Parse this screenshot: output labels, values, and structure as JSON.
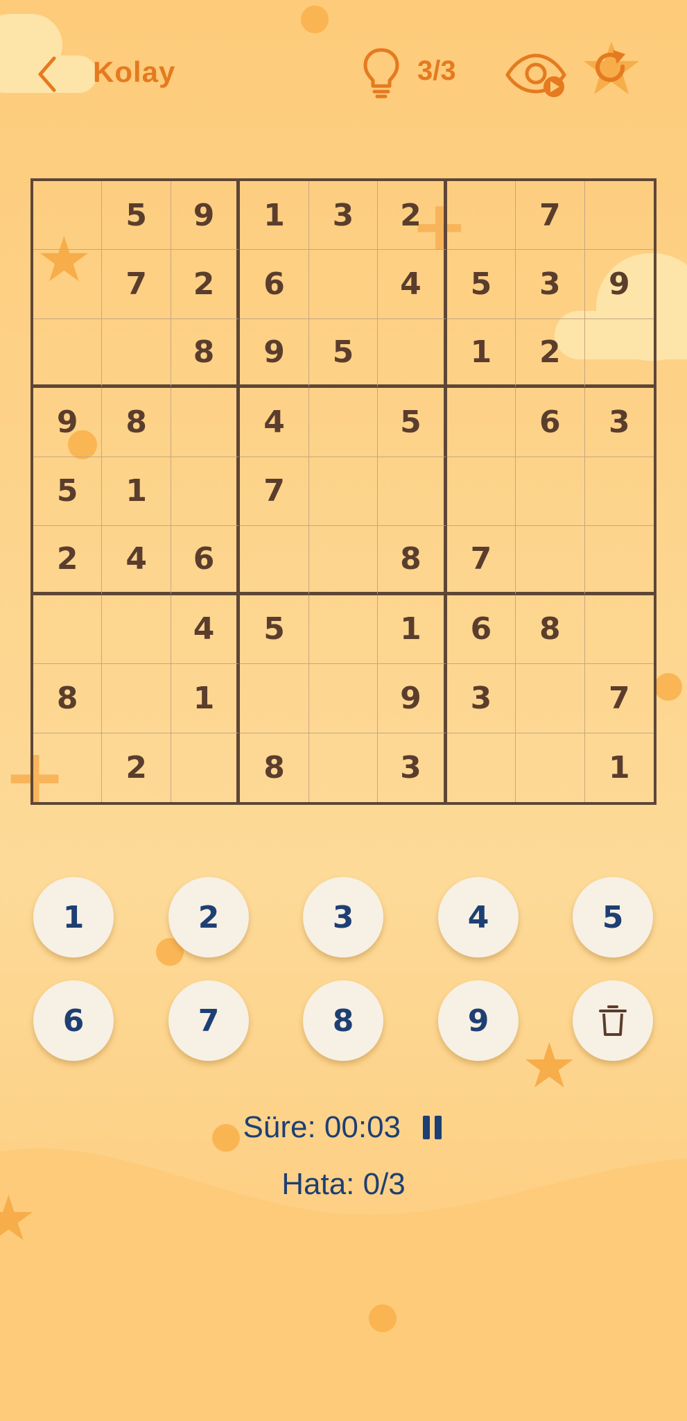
{
  "header": {
    "level_title": "Kolay",
    "hint_count": "3/3",
    "icons": [
      "chevron-left-icon",
      "lightbulb-icon",
      "eye-icon",
      "restart-icon"
    ]
  },
  "board": {
    "rows": [
      [
        "",
        "5",
        "9",
        "1",
        "3",
        "2",
        "",
        "7",
        ""
      ],
      [
        "",
        "7",
        "2",
        "6",
        "",
        "4",
        "5",
        "3",
        "9"
      ],
      [
        "",
        "",
        "8",
        "9",
        "5",
        "",
        "1",
        "2",
        ""
      ],
      [
        "9",
        "8",
        "",
        "4",
        "",
        "5",
        "",
        "6",
        "3"
      ],
      [
        "5",
        "1",
        "",
        "7",
        "",
        "",
        "",
        "",
        ""
      ],
      [
        "2",
        "4",
        "6",
        "",
        "",
        "8",
        "7",
        "",
        ""
      ],
      [
        "",
        "",
        "4",
        "5",
        "",
        "1",
        "6",
        "8",
        ""
      ],
      [
        "8",
        "",
        "1",
        "",
        "",
        "9",
        "3",
        "",
        "7"
      ],
      [
        "",
        "2",
        "",
        "8",
        "",
        "3",
        "",
        "",
        "1"
      ]
    ]
  },
  "keypad": {
    "keys": [
      "1",
      "2",
      "3",
      "4",
      "5",
      "6",
      "7",
      "8",
      "9"
    ],
    "erase_icon": "trash-icon"
  },
  "status": {
    "timer": "Süre: 00:03",
    "errors": "Hata: 0/3"
  },
  "colors": {
    "accent": "#e57a1f",
    "number_blue": "#1d3f73",
    "grid_brown": "#5e4636",
    "cell_text": "#5a3d2c"
  }
}
